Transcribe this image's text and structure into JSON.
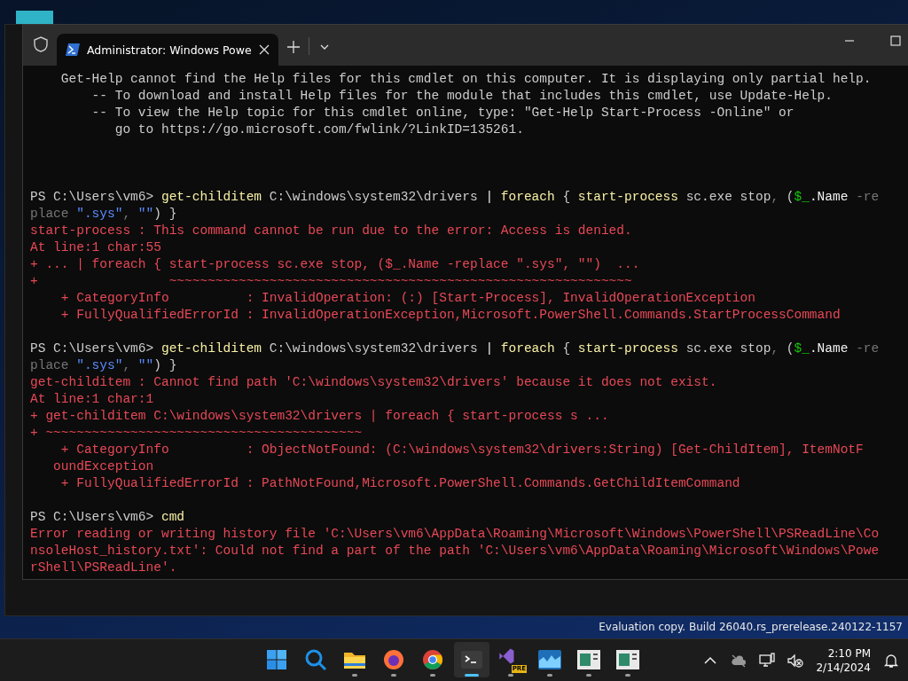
{
  "window": {
    "tab": {
      "title": "Administrator: Windows Powe",
      "selected": true
    }
  },
  "terminal": {
    "blocks": [
      {
        "kind": "help",
        "lines": [
          [
            {
              "text": "    Get-Help cannot find the Help files for this cmdlet on this computer. It is displaying only partial help.",
              "kind": "plain"
            }
          ],
          [
            {
              "text": "        -- To download and install Help files for the module that includes this cmdlet, use Update-Help.",
              "kind": "plain"
            }
          ],
          [
            {
              "text": "        -- To view the Help topic for this cmdlet online, type: \"Get-Help Start-Process -Online\" or",
              "kind": "plain"
            }
          ],
          [
            {
              "text": "           go to https://go.microsoft.com/fwlink/?LinkID=135261.",
              "kind": "plain"
            }
          ]
        ]
      },
      {
        "kind": "command",
        "lines": [
          [
            {
              "text": "PS C:\\Users\\vm6> ",
              "kind": "plain"
            },
            {
              "text": "get-childitem",
              "kind": "command"
            },
            {
              "text": " C:\\windows\\system32\\drivers ",
              "kind": "plain"
            },
            {
              "text": "| ",
              "kind": "operator"
            },
            {
              "text": "foreach",
              "kind": "command"
            },
            {
              "text": " { ",
              "kind": "plain"
            },
            {
              "text": "start-process",
              "kind": "command"
            },
            {
              "text": " sc.exe stop",
              "kind": "plain"
            },
            {
              "text": ",",
              "kind": "dim"
            },
            {
              "text": " (",
              "kind": "plain"
            },
            {
              "text": "$_",
              "kind": "variable"
            },
            {
              "text": ".Name ",
              "kind": "operator"
            },
            {
              "text": "-re",
              "kind": "dim"
            }
          ],
          [
            {
              "text": "place ",
              "kind": "dim"
            },
            {
              "text": "\".sys\"",
              "kind": "string"
            },
            {
              "text": ", ",
              "kind": "dim"
            },
            {
              "text": "\"\"",
              "kind": "string"
            },
            {
              "text": ") }",
              "kind": "plain"
            }
          ],
          [
            {
              "text": "start-process : This command cannot be run due to the error: Access is denied.",
              "kind": "error"
            }
          ],
          [
            {
              "text": "At line:1 char:55",
              "kind": "error"
            }
          ],
          [
            {
              "text": "+ ... | foreach { start-process sc.exe stop, ($_.Name -replace \".sys\", \"\")  ...",
              "kind": "error"
            }
          ],
          [
            {
              "text": "+                 ~~~~~~~~~~~~~~~~~~~~~~~~~~~~~~~~~~~~~~~~~~~~~~~~~~~~~~~~~~~~",
              "kind": "error"
            }
          ],
          [
            {
              "text": "    + CategoryInfo          : InvalidOperation: (:) [Start-Process], InvalidOperationException",
              "kind": "error"
            }
          ],
          [
            {
              "text": "    + FullyQualifiedErrorId : InvalidOperationException,Microsoft.PowerShell.Commands.StartProcessCommand",
              "kind": "error"
            }
          ]
        ]
      },
      {
        "kind": "command",
        "lines": [
          [
            {
              "text": "PS C:\\Users\\vm6> ",
              "kind": "plain"
            },
            {
              "text": "get-childitem",
              "kind": "command"
            },
            {
              "text": " C:\\windows\\system32\\drivers ",
              "kind": "plain"
            },
            {
              "text": "| ",
              "kind": "operator"
            },
            {
              "text": "foreach",
              "kind": "command"
            },
            {
              "text": " { ",
              "kind": "plain"
            },
            {
              "text": "start-process",
              "kind": "command"
            },
            {
              "text": " sc.exe stop",
              "kind": "plain"
            },
            {
              "text": ",",
              "kind": "dim"
            },
            {
              "text": " (",
              "kind": "plain"
            },
            {
              "text": "$_",
              "kind": "variable"
            },
            {
              "text": ".Name ",
              "kind": "operator"
            },
            {
              "text": "-re",
              "kind": "dim"
            }
          ],
          [
            {
              "text": "place ",
              "kind": "dim"
            },
            {
              "text": "\".sys\"",
              "kind": "string"
            },
            {
              "text": ", ",
              "kind": "dim"
            },
            {
              "text": "\"\"",
              "kind": "string"
            },
            {
              "text": ") }",
              "kind": "plain"
            }
          ],
          [
            {
              "text": "get-childitem : Cannot find path 'C:\\windows\\system32\\drivers' because it does not exist.",
              "kind": "error"
            }
          ],
          [
            {
              "text": "At line:1 char:1",
              "kind": "error"
            }
          ],
          [
            {
              "text": "+ get-childitem C:\\windows\\system32\\drivers | foreach { start-process s ...",
              "kind": "error"
            }
          ],
          [
            {
              "text": "+ ~~~~~~~~~~~~~~~~~~~~~~~~~~~~~~~~~~~~~~~~~",
              "kind": "error"
            }
          ],
          [
            {
              "text": "    + CategoryInfo          : ObjectNotFound: (C:\\windows\\system32\\drivers:String) [Get-ChildItem], ItemNotF",
              "kind": "error"
            }
          ],
          [
            {
              "text": "   oundException",
              "kind": "error"
            }
          ],
          [
            {
              "text": "    + FullyQualifiedErrorId : PathNotFound,Microsoft.PowerShell.Commands.GetChildItemCommand",
              "kind": "error"
            }
          ]
        ]
      },
      {
        "kind": "command",
        "lines": [
          [
            {
              "text": "PS C:\\Users\\vm6> ",
              "kind": "plain"
            },
            {
              "text": "cmd",
              "kind": "command"
            }
          ],
          [
            {
              "text": "Error reading or writing history file 'C:\\Users\\vm6\\AppData\\Roaming\\Microsoft\\Windows\\PowerShell\\PSReadLine\\Co",
              "kind": "error"
            }
          ],
          [
            {
              "text": "nsoleHost_history.txt': Could not find a part of the path 'C:\\Users\\vm6\\AppData\\Roaming\\Microsoft\\Windows\\Powe",
              "kind": "error"
            }
          ],
          [
            {
              "text": "rShell\\PSReadLine'.",
              "kind": "error"
            }
          ]
        ]
      }
    ]
  },
  "desktop": {
    "watermark": "Evaluation copy. Build 26040.rs_prerelease.240122-1157"
  },
  "taskbar": {
    "apps": [
      {
        "kind": "start",
        "active": false
      },
      {
        "kind": "search",
        "active": false
      },
      {
        "kind": "explorer",
        "active": false
      },
      {
        "kind": "firefox",
        "active": false
      },
      {
        "kind": "chrome",
        "active": false
      },
      {
        "kind": "terminal",
        "active": true
      },
      {
        "kind": "studio",
        "active": false,
        "badge": "PRE"
      },
      {
        "kind": "chart",
        "active": false
      },
      {
        "kind": "notepad",
        "active": false
      },
      {
        "kind": "notepad",
        "active": false
      }
    ],
    "time": "2:10 PM",
    "date": "2/14/2024"
  }
}
